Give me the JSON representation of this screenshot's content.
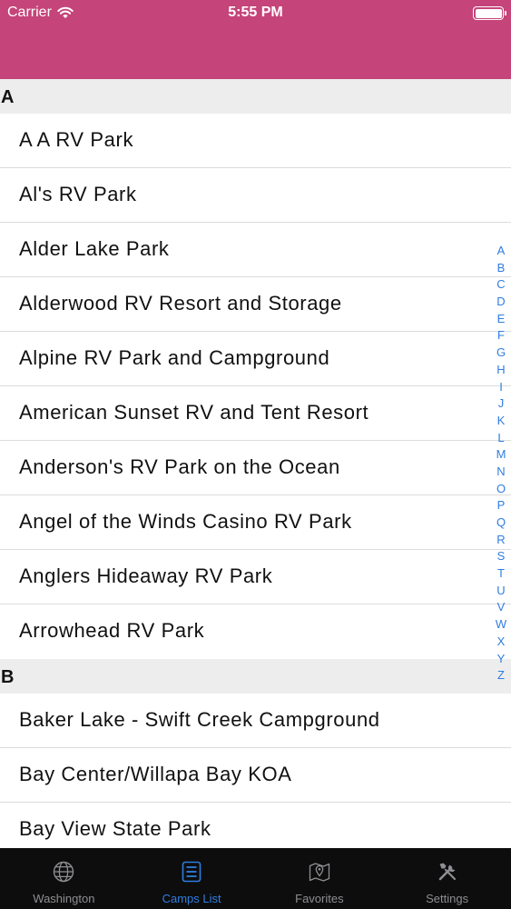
{
  "status_bar": {
    "carrier": "Carrier",
    "time": "5:55 PM"
  },
  "colors": {
    "nav_bar": "#c54479",
    "accent": "#2f7de1",
    "tab_bar_bg": "#0d0d0d",
    "tab_inactive": "#8e8e93"
  },
  "sections": [
    {
      "title": "A",
      "items": [
        "A A RV Park",
        "Al's RV Park",
        "Alder Lake Park",
        "Alderwood RV Resort and Storage",
        "Alpine RV Park and Campground",
        "American Sunset RV and Tent Resort",
        "Anderson's RV Park on the Ocean",
        "Angel of the Winds Casino RV Park",
        "Anglers Hideaway RV Park",
        "Arrowhead RV Park"
      ]
    },
    {
      "title": "B",
      "items": [
        "Baker Lake - Swift Creek Campground",
        "Bay Center/Willapa Bay KOA",
        "Bay View State Park"
      ]
    }
  ],
  "index_letters": [
    "A",
    "B",
    "C",
    "D",
    "E",
    "F",
    "G",
    "H",
    "I",
    "J",
    "K",
    "L",
    "M",
    "N",
    "O",
    "P",
    "Q",
    "R",
    "S",
    "T",
    "U",
    "V",
    "W",
    "X",
    "Y",
    "Z"
  ],
  "tabs": [
    {
      "label": "Washington",
      "icon": "globe-icon",
      "active": false
    },
    {
      "label": "Camps List",
      "icon": "list-icon",
      "active": true
    },
    {
      "label": "Favorites",
      "icon": "map-pin-icon",
      "active": false
    },
    {
      "label": "Settings",
      "icon": "tools-icon",
      "active": false
    }
  ]
}
